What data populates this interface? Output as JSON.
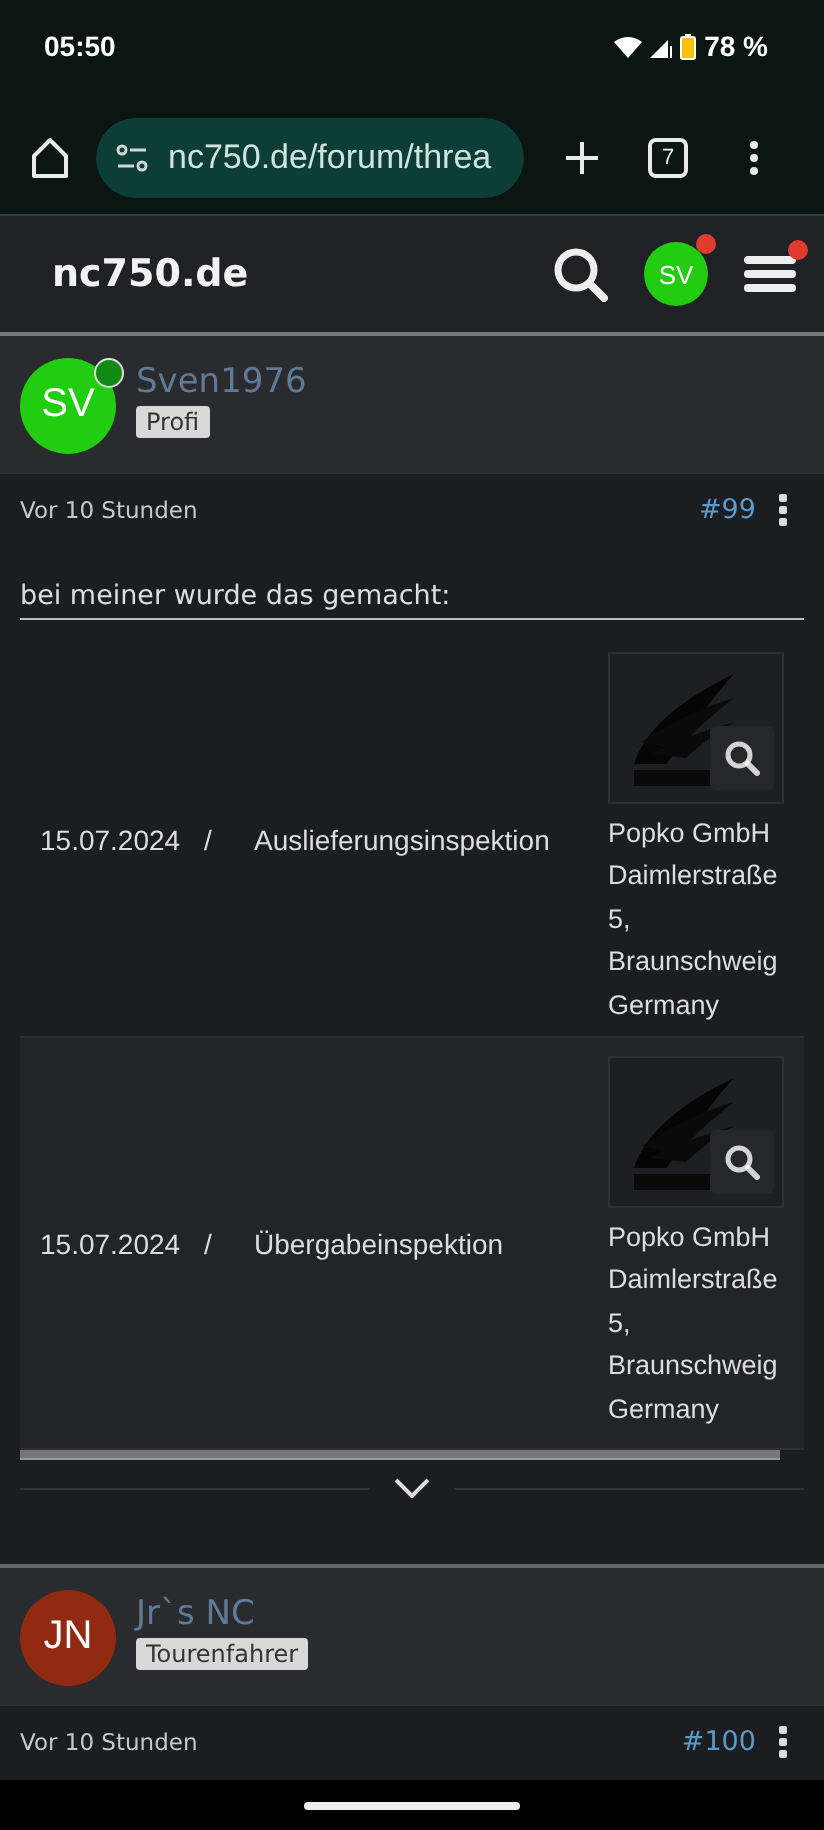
{
  "status_bar": {
    "time": "05:50",
    "battery": "78 %"
  },
  "browser": {
    "url": "nc750.de/forum/threa",
    "tab_count": "7"
  },
  "site_header": {
    "logo": "nc750.de",
    "avatar_initials": "SV",
    "avatar_alert": true,
    "menu_alert": true
  },
  "posts": [
    {
      "author": "Sven1976",
      "initials": "SV",
      "color": "#22cc11",
      "online": true,
      "rank": "Profi",
      "time": "Vor 10 Stunden",
      "number": "#99",
      "intro": "bei meiner wurde das gemacht:",
      "rows": [
        {
          "date": "15.07.2024",
          "separator": "/",
          "service": "Auslieferungsinspektion",
          "dealer": "Popko GmbH Daimlerstraße 5, Braunschweig Germany"
        },
        {
          "date": "15.07.2024",
          "separator": "/",
          "service": "Übergabeinspektion",
          "dealer": "Popko GmbH Daimlerstraße 5, Braunschweig Germany"
        }
      ]
    },
    {
      "author": "Jr`s NC",
      "initials": "JN",
      "color": "#922a12",
      "online": false,
      "rank": "Tourenfahrer",
      "time": "Vor 10 Stunden",
      "number": "#100"
    }
  ]
}
